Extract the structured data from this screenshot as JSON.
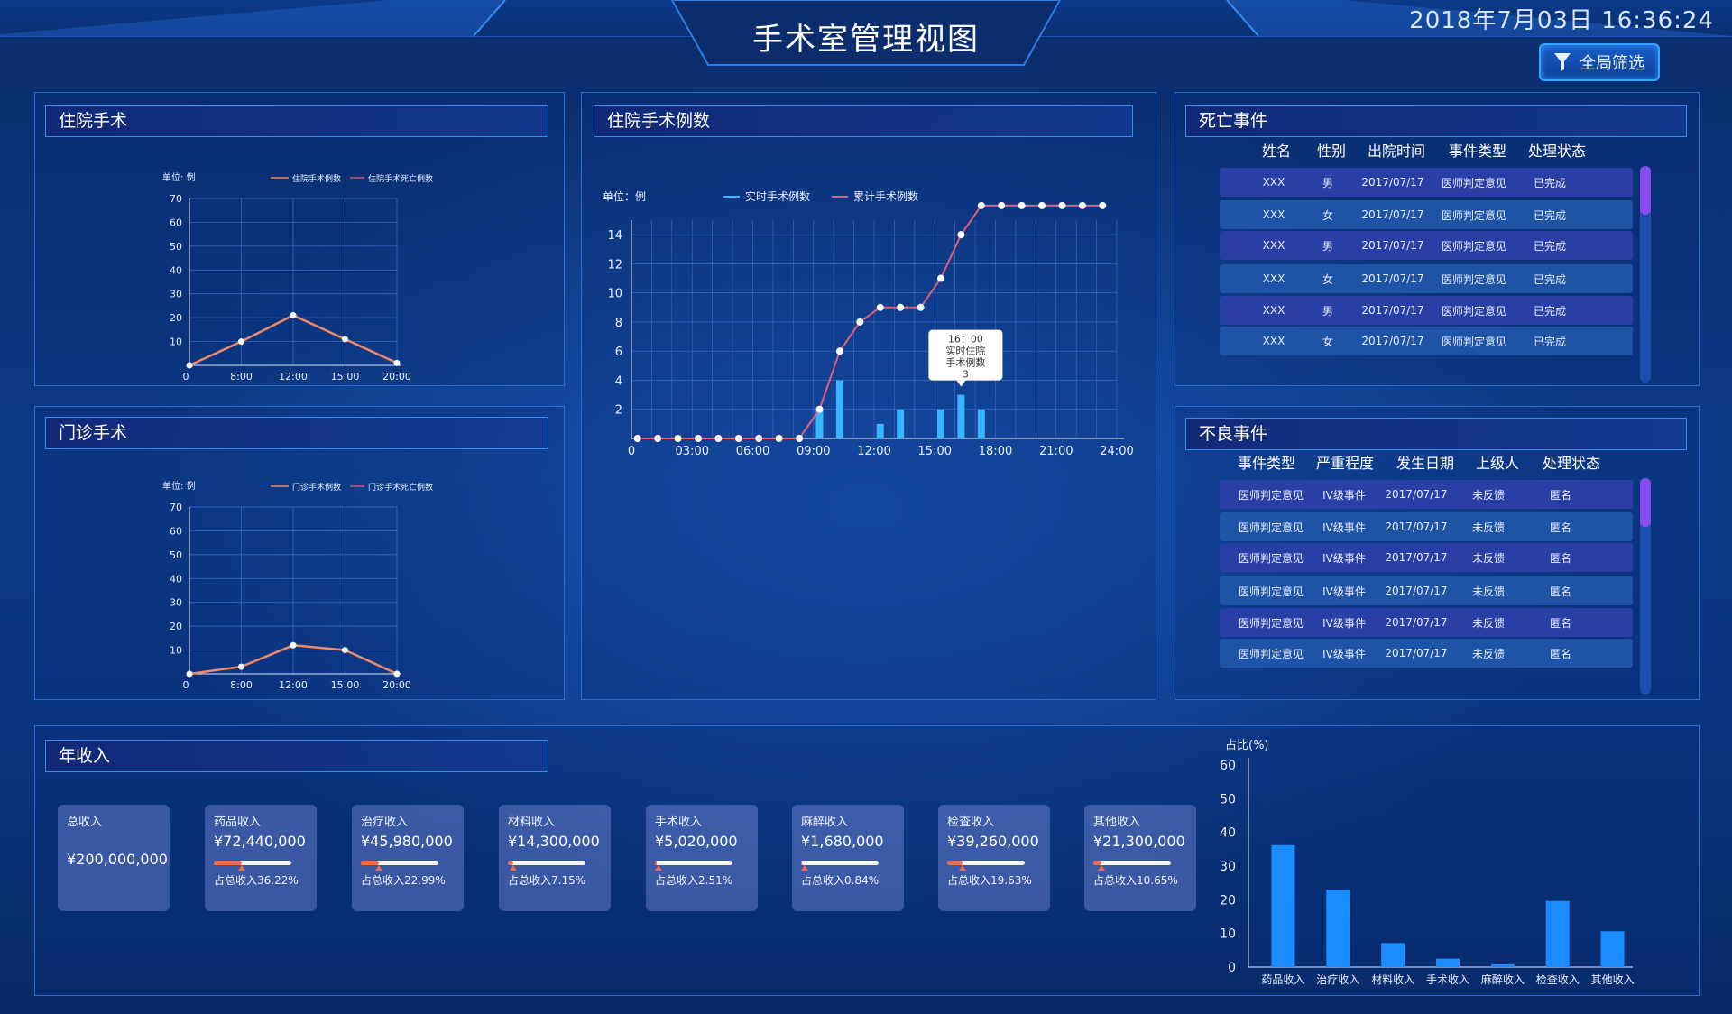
{
  "header": {
    "title": "手术室管理视图",
    "datetime": "2018年7月03日   16:36:24",
    "filter_label": "全局筛选"
  },
  "inpatient_surgery": {
    "title": "住院手术",
    "unit": "单位: 例",
    "legend": [
      "住院手术例数",
      "住院手术死亡例数"
    ],
    "chart_data": {
      "type": "line",
      "x": [
        "0",
        "8:00",
        "12:00",
        "15:00",
        "20:00"
      ],
      "series": [
        {
          "name": "住院手术例数",
          "values": [
            0,
            10,
            21,
            11,
            1
          ]
        }
      ],
      "ylim": [
        0,
        70
      ],
      "yticks": [
        10,
        20,
        30,
        40,
        50,
        60,
        70
      ],
      "color": "#f08a6a"
    }
  },
  "outpatient_surgery": {
    "title": "门诊手术",
    "unit": "单位: 例",
    "legend": [
      "门诊手术例数",
      "门诊手术死亡例数"
    ],
    "chart_data": {
      "type": "line",
      "x": [
        "0",
        "8:00",
        "12:00",
        "15:00",
        "20:00"
      ],
      "series": [
        {
          "name": "门诊手术例数",
          "values": [
            0,
            3,
            12,
            10,
            0
          ]
        }
      ],
      "ylim": [
        0,
        70
      ],
      "yticks": [
        10,
        20,
        30,
        40,
        50,
        60,
        70
      ],
      "color": "#f08a6a"
    }
  },
  "inpatient_count": {
    "title": "住院手术例数",
    "unit": "单位：例",
    "legend": [
      "实时手术例数",
      "累计手术例数"
    ],
    "tooltip": [
      "16：00",
      "实时住院",
      "手术例数",
      "3"
    ],
    "chart_data": {
      "type": "line",
      "xticks": [
        "0",
        "03:00",
        "06:00",
        "09:00",
        "12:00",
        "15:00",
        "18:00",
        "21:00",
        "24:00"
      ],
      "xlim": [
        0,
        24
      ],
      "ylim": [
        0,
        15
      ],
      "yticks": [
        2,
        4,
        6,
        8,
        10,
        12,
        14
      ],
      "series": [
        {
          "name": "累计手术例数",
          "color": "#e0607a",
          "x": [
            0.3,
            1.3,
            2.3,
            3.3,
            4.3,
            5.3,
            6.3,
            7.3,
            8.3,
            9.3,
            10.3,
            11.3,
            12.3,
            13.3,
            14.3,
            15.3,
            16.3,
            17.3,
            18.3,
            19.3,
            20.3,
            21.3,
            22.3,
            23.3
          ],
          "values": [
            0,
            0,
            0,
            0,
            0,
            0,
            0,
            0,
            0,
            2,
            6,
            8,
            9,
            9,
            9,
            11,
            14,
            16,
            16,
            16,
            16,
            16,
            16,
            16
          ]
        },
        {
          "name": "实时手术例数",
          "type": "bar",
          "color": "#3ab6ff",
          "x": [
            9.3,
            10.3,
            12.3,
            13.3,
            15.3,
            16.3,
            17.3
          ],
          "values": [
            2,
            4,
            1,
            2,
            2,
            3,
            2
          ]
        }
      ]
    }
  },
  "death_events": {
    "title": "死亡事件",
    "columns": [
      "姓名",
      "性别",
      "出院时间",
      "事件类型",
      "处理状态"
    ],
    "rows": [
      [
        "XXX",
        "男",
        "2017/07/17",
        "医师判定意见",
        "已完成"
      ],
      [
        "XXX",
        "女",
        "2017/07/17",
        "医师判定意见",
        "已完成"
      ],
      [
        "XXX",
        "男",
        "2017/07/17",
        "医师判定意见",
        "已完成"
      ],
      [
        "XXX",
        "女",
        "2017/07/17",
        "医师判定意见",
        "已完成"
      ],
      [
        "XXX",
        "男",
        "2017/07/17",
        "医师判定意见",
        "已完成"
      ],
      [
        "XXX",
        "女",
        "2017/07/17",
        "医师判定意见",
        "已完成"
      ]
    ]
  },
  "adverse_events": {
    "title": "不良事件",
    "columns": [
      "事件类型",
      "严重程度",
      "发生日期",
      "上级人",
      "处理状态"
    ],
    "rows": [
      [
        "医师判定意见",
        "IV级事件",
        "2017/07/17",
        "未反馈",
        "匿名"
      ],
      [
        "医师判定意见",
        "IV级事件",
        "2017/07/17",
        "未反馈",
        "匿名"
      ],
      [
        "医师判定意见",
        "IV级事件",
        "2017/07/17",
        "未反馈",
        "匿名"
      ],
      [
        "医师判定意见",
        "IV级事件",
        "2017/07/17",
        "未反馈",
        "匿名"
      ],
      [
        "医师判定意见",
        "IV级事件",
        "2017/07/17",
        "未反馈",
        "匿名"
      ],
      [
        "医师判定意见",
        "IV级事件",
        "2017/07/17",
        "未反馈",
        "匿名"
      ]
    ]
  },
  "annual_income": {
    "title": "年收入",
    "total": {
      "label": "总收入",
      "value": "¥200,000,000"
    },
    "cards": [
      {
        "label": "药品收入",
        "value": "¥72,440,000",
        "pct_text": "占总收入36.22%",
        "pct": 36.22
      },
      {
        "label": "治疗收入",
        "value": "¥45,980,000",
        "pct_text": "占总收入22.99%",
        "pct": 22.99
      },
      {
        "label": "材料收入",
        "value": "¥14,300,000",
        "pct_text": "占总收入7.15%",
        "pct": 7.15
      },
      {
        "label": "手术收入",
        "value": "¥5,020,000",
        "pct_text": "占总收入2.51%",
        "pct": 2.51
      },
      {
        "label": "麻醉收入",
        "value": "¥1,680,000",
        "pct_text": "占总收入0.84%",
        "pct": 0.84
      },
      {
        "label": "检查收入",
        "value": "¥39,260,000",
        "pct_text": "占总收入19.63%",
        "pct": 19.63
      },
      {
        "label": "其他收入",
        "value": "¥21,300,000",
        "pct_text": "占总收入10.65%",
        "pct": 10.65
      }
    ],
    "chart_data": {
      "type": "bar",
      "ylabel": "占比(%)",
      "categories": [
        "药品收入",
        "治疗收入",
        "材料收入",
        "手术收入",
        "麻醉收入",
        "检查收入",
        "其他收入"
      ],
      "values": [
        36.22,
        22.99,
        7.15,
        2.51,
        0.84,
        19.63,
        10.65
      ],
      "ylim": [
        0,
        60
      ],
      "yticks": [
        0,
        10,
        20,
        30,
        40,
        50,
        60
      ],
      "color": "#1a8cff"
    }
  }
}
